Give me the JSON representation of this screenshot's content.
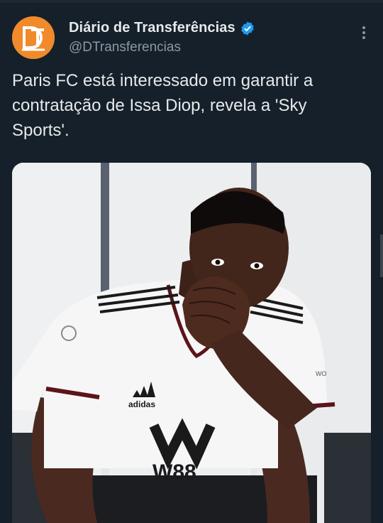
{
  "tweet": {
    "display_name": "Diário de Transferências",
    "handle": "@DTransferencias",
    "avatar_text": "DT",
    "verified_icon": "verified-badge-icon",
    "more_icon": "more-options-icon",
    "text": "Paris FC está interessado em garantir a contratação de Issa Diop, revela a 'Sky Sports'."
  },
  "media": {
    "shirt_brand": "adidas",
    "shirt_sponsor": "W88",
    "sleeve_text": "WO"
  },
  "colors": {
    "background": "#15202b",
    "avatar": "#f08a2a",
    "verified": "#1d9bf0",
    "handle": "#8b98a5"
  }
}
